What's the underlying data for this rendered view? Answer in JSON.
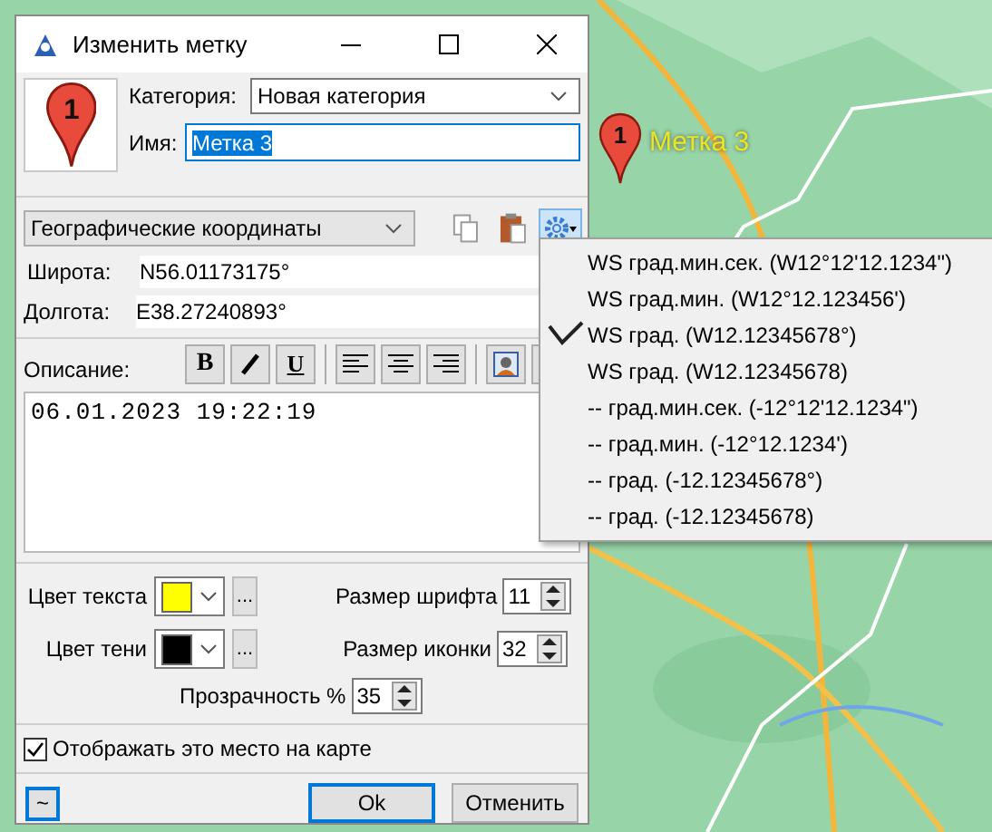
{
  "window": {
    "title": "Изменить метку"
  },
  "category": {
    "label": "Категория:",
    "value": "Новая категория"
  },
  "icon": {
    "number": "1"
  },
  "name": {
    "label": "Имя:",
    "value": "Метка 3",
    "text_selected": true
  },
  "coord_format": {
    "value": "Географические координаты"
  },
  "latitude": {
    "label": "Широта:",
    "value": "N56.01173175°"
  },
  "longitude": {
    "label": "Долгота:",
    "value": "E38.27240893°"
  },
  "description": {
    "label": "Описание:",
    "value": "06.01.2023 19:22:19"
  },
  "format_buttons": [
    {
      "kind": "bold",
      "label": "B"
    },
    {
      "kind": "italic"
    },
    {
      "kind": "underline",
      "label": "U"
    }
  ],
  "text_color": {
    "label": "Цвет текста",
    "color": "#ffff00",
    "more": "..."
  },
  "shadow_color": {
    "label": "Цвет тени",
    "color": "#000000",
    "more": "..."
  },
  "font_size": {
    "label": "Размер шрифта",
    "value": "11"
  },
  "icon_size": {
    "label": "Размер иконки",
    "value": "32"
  },
  "opacity": {
    "label": "Прозрачность %",
    "value": "35"
  },
  "show_on_map": {
    "label": "Отображать это место на карте",
    "checked": true
  },
  "buttons": {
    "extra": "~",
    "ok": "Ok",
    "cancel": "Отменить"
  },
  "format_menu": [
    {
      "label": "WS град.мин.сек. (W12°12'12.1234\")",
      "selected": false
    },
    {
      "label": "WS град.мин. (W12°12.123456')",
      "selected": false
    },
    {
      "label": "WS град. (W12.12345678°)",
      "selected": true
    },
    {
      "label": "WS град. (W12.12345678)",
      "selected": false
    },
    {
      "label": "-- град.мин.сек. (-12°12'12.1234\")",
      "selected": false
    },
    {
      "label": "-- град.мин. (-12°12.1234')",
      "selected": false
    },
    {
      "label": "-- град. (-12.12345678°)",
      "selected": false
    },
    {
      "label": "-- град. (-12.12345678)",
      "selected": false
    }
  ],
  "map_marker": {
    "number": "1",
    "label": "Метка 3"
  }
}
